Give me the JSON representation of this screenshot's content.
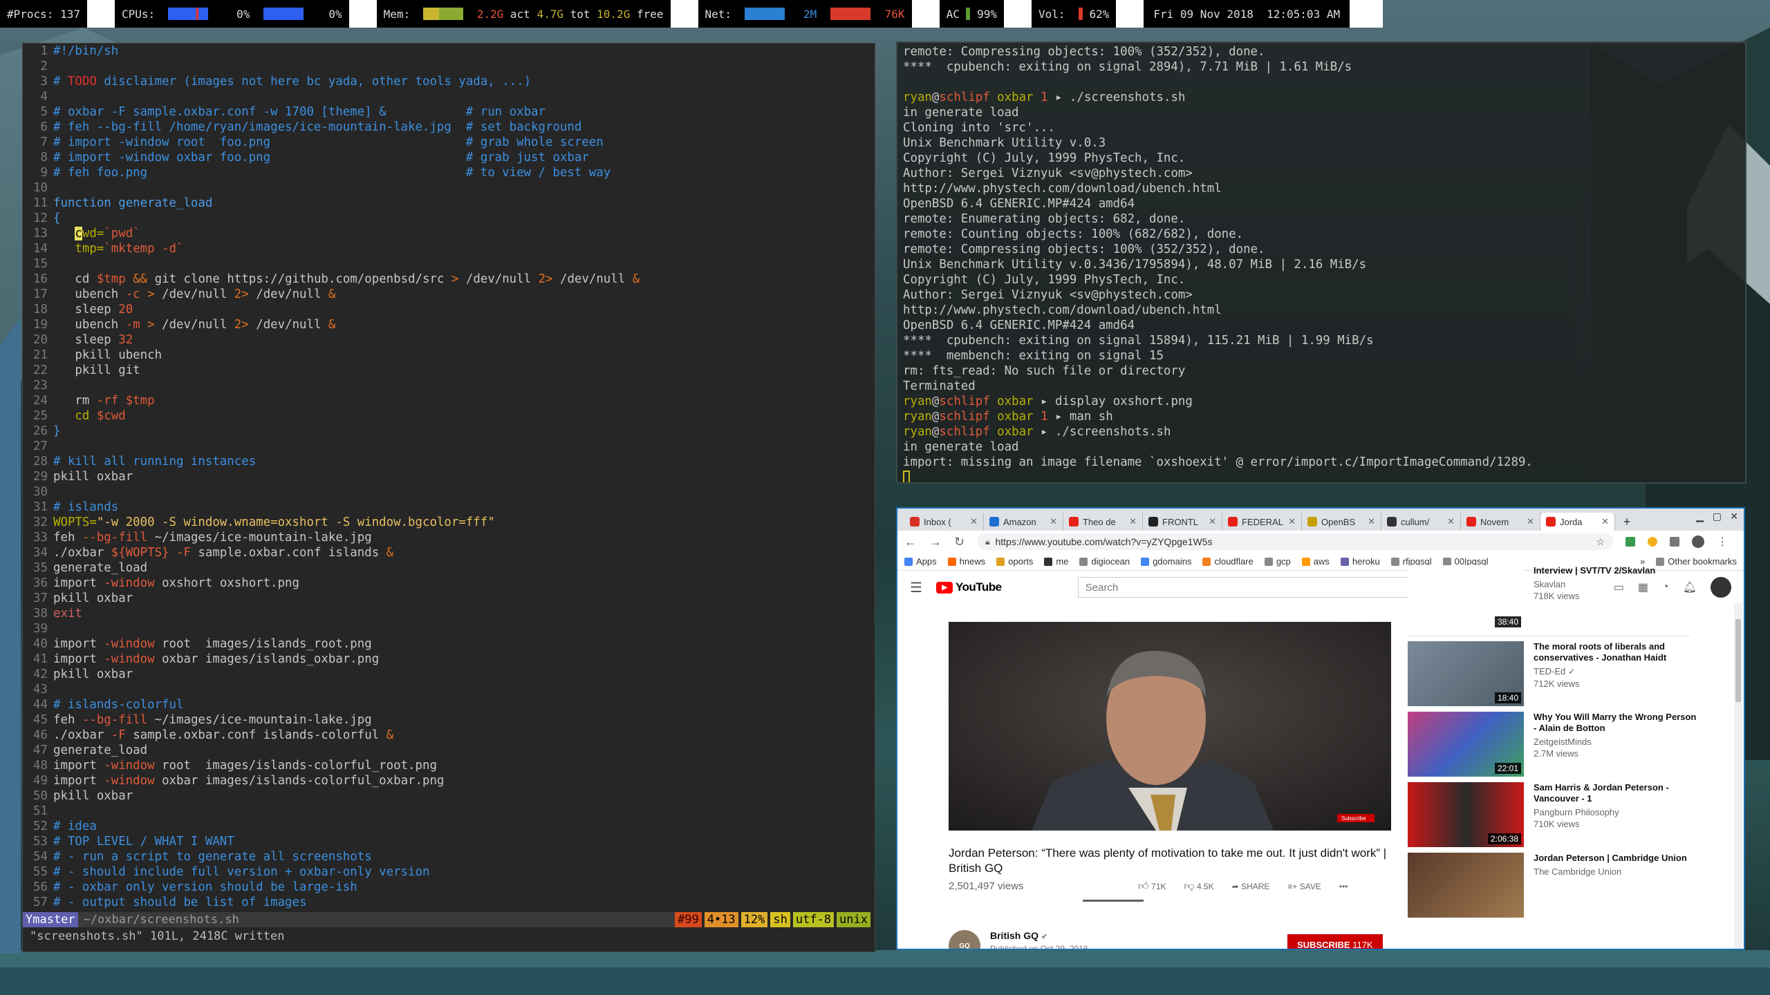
{
  "topbar": {
    "procs": "#Procs: 137",
    "cpus_label": "CPUs:",
    "cpu1": "0%",
    "cpu2": "0%",
    "mem_label": "Mem:",
    "mem_act": "2.2G",
    "mem_act_label": "act",
    "mem_tot": "4.7G",
    "mem_tot_label": "tot",
    "mem_free": "10.2G",
    "mem_free_label": "free",
    "net_label": "Net:",
    "net_in": "2M",
    "net_out": "76K",
    "ac": "AC",
    "battery": "99%",
    "battery_level": 0.99,
    "vol_label": "Vol:",
    "vol": "62%",
    "vol_level": 0.62,
    "clock": "Fri 09 Nov 2018  12:05:03 AM"
  },
  "vim": {
    "status": {
      "branch": "Ymaster",
      "file": "~/oxbar/screenshots.sh",
      "pills": [
        "#99",
        "4•13",
        "12%",
        "sh",
        "utf-8",
        "unix"
      ]
    },
    "message": "\"screenshots.sh\" 101L, 2418C written"
  },
  "terminal": {
    "lines": [
      "remote: Compressing objects: 100% (352/352), done.",
      "****  cpubench: exiting on signal 2894), 7.71 MiB | 1.61 MiB/s",
      "",
      "P|ryan|schlipf|oxbar|1|./screenshots.sh",
      "in generate load",
      "Cloning into 'src'...",
      "Unix Benchmark Utility v.0.3",
      "Copyright (C) July, 1999 PhysTech, Inc.",
      "Author: Sergei Viznyuk <sv@phystech.com>",
      "http://www.phystech.com/download/ubench.html",
      "OpenBSD 6.4 GENERIC.MP#424 amd64",
      "remote: Enumerating objects: 682, done.",
      "remote: Counting objects: 100% (682/682), done.",
      "remote: Compressing objects: 100% (352/352), done.",
      "Unix Benchmark Utility v.0.3436/1795894), 48.07 MiB | 2.16 MiB/s",
      "Copyright (C) July, 1999 PhysTech, Inc.",
      "Author: Sergei Viznyuk <sv@phystech.com>",
      "http://www.phystech.com/download/ubench.html",
      "OpenBSD 6.4 GENERIC.MP#424 amd64",
      "****  cpubench: exiting on signal 15894), 115.21 MiB | 1.99 MiB/s",
      "****  membench: exiting on signal 15",
      "rm: fts_read: No such file or directory",
      "Terminated",
      "P|ryan|schlipf|oxbar||display oxshort.png",
      "P|ryan|schlipf|oxbar|1|man sh",
      "P|ryan|schlipf|oxbar||./screenshots.sh",
      "in generate load",
      "import: missing an image filename `oxshoexit' @ error/import.c/ImportImageCommand/1289."
    ]
  },
  "chrome": {
    "tabs": [
      {
        "label": "Inbox (",
        "color": "#d93025"
      },
      {
        "label": "Amazon",
        "color": "#1f6fd0"
      },
      {
        "label": "Theo de",
        "color": "#e62117"
      },
      {
        "label": "FRONTL",
        "color": "#222"
      },
      {
        "label": "FEDERAL",
        "color": "#e62117"
      },
      {
        "label": "OpenBS",
        "color": "#c8a000"
      },
      {
        "label": "cullum/",
        "color": "#333"
      },
      {
        "label": "Novem",
        "color": "#e62117"
      },
      {
        "label": "Jorda",
        "color": "#e62117"
      }
    ],
    "new_tab": "+",
    "url": "https://www.youtube.com/watch?v=yZYQpge1W5s",
    "bookmarks": [
      {
        "label": "Apps",
        "color": "#4285f4"
      },
      {
        "label": "hnews",
        "color": "#ff6600"
      },
      {
        "label": "oports",
        "color": "#e0a020"
      },
      {
        "label": "me",
        "color": "#333"
      },
      {
        "label": "digiocean",
        "color": "#888"
      },
      {
        "label": "gdomains",
        "color": "#4285f4"
      },
      {
        "label": "cloudflare",
        "color": "#f38020"
      },
      {
        "label": "gcp",
        "color": "#888"
      },
      {
        "label": "aws",
        "color": "#ff9900"
      },
      {
        "label": "heroku",
        "color": "#6762a6"
      },
      {
        "label": "rfjpgsql",
        "color": "#888"
      },
      {
        "label": "00|pgsql",
        "color": "#888"
      }
    ],
    "bm_more": "»",
    "other_bookmarks": "Other bookmarks"
  },
  "youtube": {
    "logo": "YouTube",
    "search_placeholder": "Search",
    "video_title": "Jordan Peterson: “There was plenty of motivation to take me out. It just didn't work” | British GQ",
    "views": "2,501,497 views",
    "likes": "71K",
    "dislikes": "4.5K",
    "share": "SHARE",
    "save": "SAVE",
    "more": "•••",
    "channel": "British GQ",
    "published": "Published on Oct 29, 2018",
    "subscribe": "SUBSCRIBE",
    "subs": "117K",
    "player_badge": "Subscribe",
    "sidebar": [
      {
        "title": "Interview | SVT/TV 2/Skavlan",
        "channel": "Skavlan",
        "views": "718K views",
        "duration": "38:40"
      },
      {
        "title": "The moral roots of liberals and conservatives - Jonathan Haidt",
        "channel": "TED-Ed ✓",
        "views": "712K views",
        "duration": "18:40"
      },
      {
        "title": "Why You Will Marry the Wrong Person - Alain de Botton",
        "channel": "ZeitgeistMinds",
        "views": "2.7M views",
        "duration": "22:01"
      },
      {
        "title": "Sam Harris & Jordan Peterson - Vancouver - 1",
        "channel": "Pangburn Philosophy",
        "views": "710K views",
        "duration": "2:06:38"
      },
      {
        "title": "Jordan Peterson | Cambridge Union",
        "channel": "The Cambridge Union",
        "views": "",
        "duration": ""
      }
    ]
  }
}
